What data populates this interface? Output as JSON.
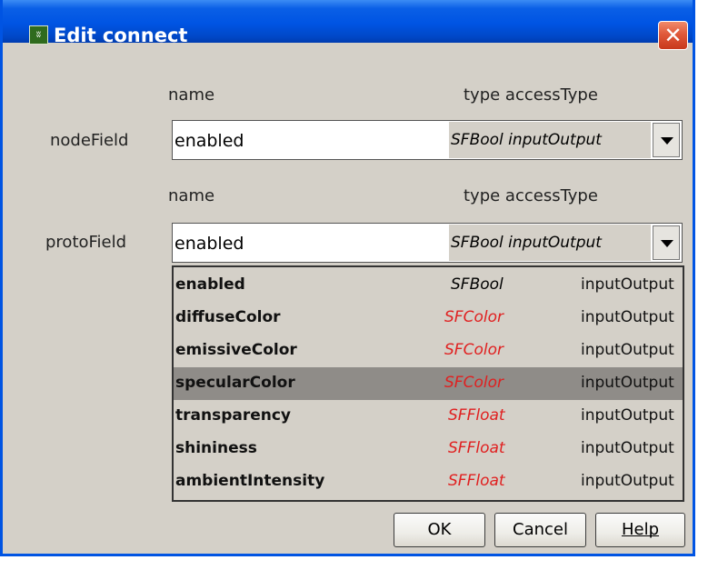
{
  "window": {
    "title": "Edit connect",
    "close_glyph": "✕"
  },
  "node": {
    "label": "nodeField",
    "header_name": "name",
    "header_type_access": "type accessType",
    "value": "enabled",
    "type_access": "SFBool inputOutput"
  },
  "proto": {
    "label": "protoField",
    "header_name": "name",
    "header_type_access": "type accessType",
    "value": "enabled",
    "type_access": "SFBool inputOutput"
  },
  "dropdown": {
    "selected_index": 3,
    "items": [
      {
        "name": "enabled",
        "type": "SFBool",
        "access": "inputOutput",
        "type_color": "#000000"
      },
      {
        "name": "diffuseColor",
        "type": "SFColor",
        "access": "inputOutput",
        "type_color": "#e02020"
      },
      {
        "name": "emissiveColor",
        "type": "SFColor",
        "access": "inputOutput",
        "type_color": "#e02020"
      },
      {
        "name": "specularColor",
        "type": "SFColor",
        "access": "inputOutput",
        "type_color": "#e02020"
      },
      {
        "name": "transparency",
        "type": "SFFloat",
        "access": "inputOutput",
        "type_color": "#e02020"
      },
      {
        "name": "shininess",
        "type": "SFFloat",
        "access": "inputOutput",
        "type_color": "#e02020"
      },
      {
        "name": "ambientIntensity",
        "type": "SFFloat",
        "access": "inputOutput",
        "type_color": "#e02020"
      }
    ]
  },
  "buttons": {
    "ok": "OK",
    "cancel": "Cancel",
    "help": "Help"
  }
}
